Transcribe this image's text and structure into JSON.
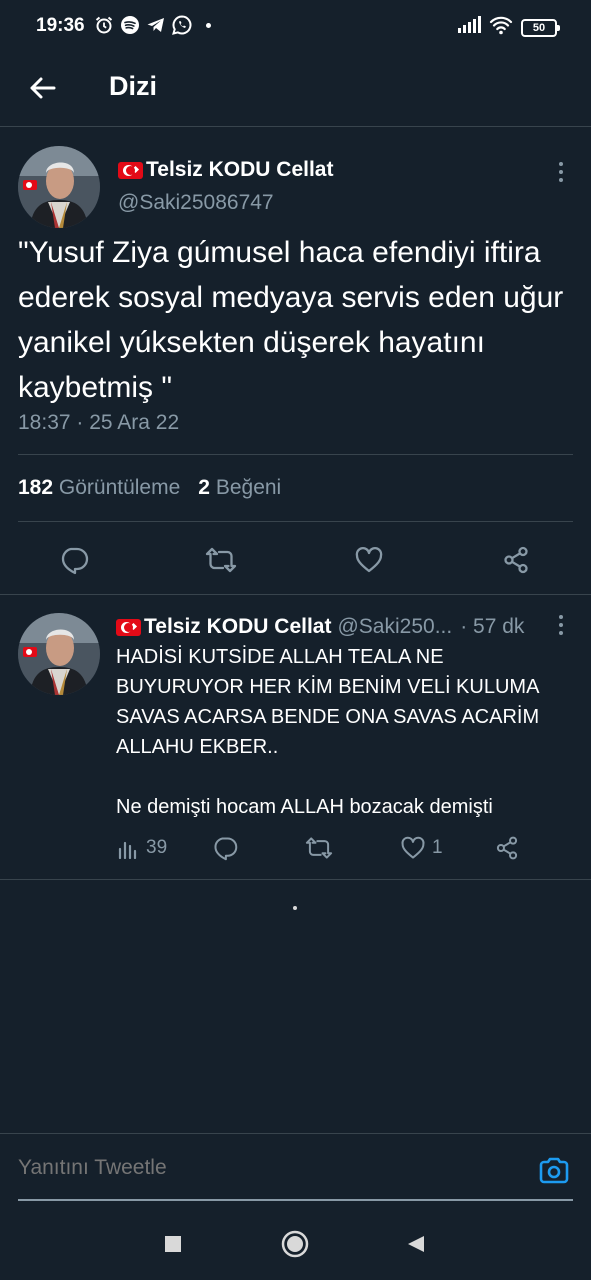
{
  "status_bar": {
    "time": "19:36",
    "battery": "50",
    "icons_left": [
      "alarm-icon",
      "spotify-icon",
      "telegram-icon",
      "whatsapp-icon"
    ],
    "icons_right": [
      "signal-icon",
      "wifi-icon",
      "battery-icon"
    ]
  },
  "header": {
    "title": "Dizi"
  },
  "main_tweet": {
    "author_name": "Telsiz KODU Cellat",
    "author_handle": "@Saki25086747",
    "text": "\"Yusuf Ziya gúmusel haca efendiyi iftira ederek sosyal medyaya servis eden uğur yanikel yúksekten düşerek hayatını kaybetmiş \"",
    "time": "18:37 · 25 Ara 22",
    "views_count": "182",
    "views_label": "Görüntüleme",
    "likes_count": "2",
    "likes_label": "Beğeni"
  },
  "reply_tweet": {
    "author_name": "Telsiz KODU Cellat",
    "author_handle": "@Saki250...",
    "time": "· 57 dk",
    "text_line1": "HADİSİ KUTSİDE ALLAH TEALA NE BUYURUYOR HER KİM BENİM VELİ KULUMA SAVAS ACARSA BENDE ONA SAVAS ACARİM ALLAHU EKBER..",
    "text_line2": "Ne demişti hocam ALLAH bozacak demişti",
    "views": "39",
    "likes": "1"
  },
  "composer": {
    "placeholder": "Yanıtını Tweetle"
  },
  "colors": {
    "background": "#15202b",
    "secondary_text": "#8899a6",
    "divider": "#38444d",
    "accent": "#1d9bf0"
  }
}
